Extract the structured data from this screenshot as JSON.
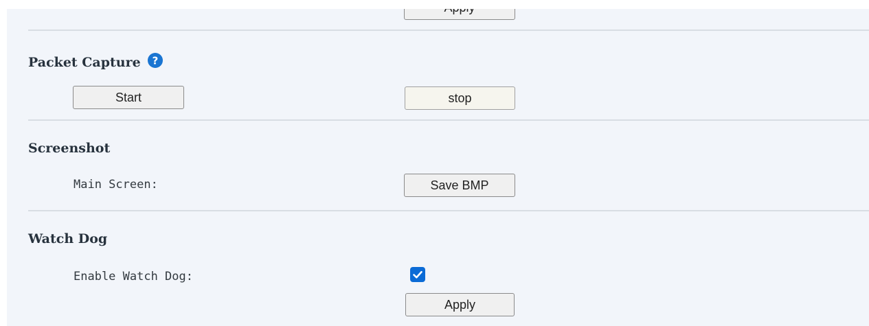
{
  "top": {
    "apply_label": "Apply"
  },
  "packet_capture": {
    "title": "Packet Capture",
    "help_icon": "question-circle-icon",
    "start_label": "Start",
    "stop_label": "stop"
  },
  "screenshot": {
    "title": "Screenshot",
    "main_screen_label": "Main Screen:",
    "save_label": "Save BMP"
  },
  "watch_dog": {
    "title": "Watch Dog",
    "enable_label": "Enable Watch Dog:",
    "enabled": true,
    "apply_label": "Apply"
  },
  "colors": {
    "panel_bg": "#f2f5fa",
    "divider": "#d8dde3",
    "title_text": "#27323d",
    "help_icon": "#1a75d2",
    "checkbox_checked": "#0b6bd6"
  }
}
